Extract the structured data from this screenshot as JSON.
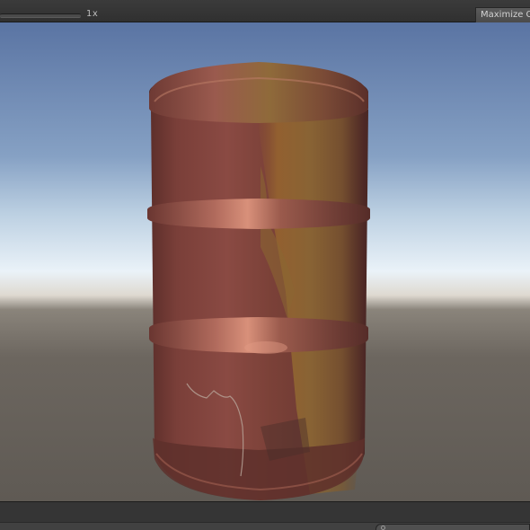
{
  "toolbar": {
    "scale_value": "1x",
    "maximize_label": "Maximize On Play"
  },
  "viewport": {
    "object": "rusty-oil-barrel",
    "colors": {
      "sky_top": "#5e79a8",
      "sky_horizon": "#e9f1f7",
      "ground": "#6a655e",
      "barrel_paint": "#8a4b43",
      "rust": "#9b6a2f"
    }
  },
  "status_bar": {
    "search_icon": "search-icon"
  }
}
